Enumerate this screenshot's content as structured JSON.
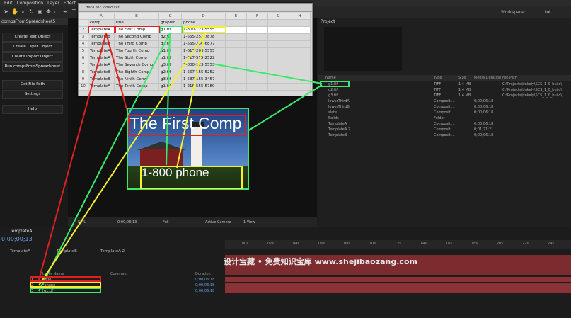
{
  "menu": [
    "Edit",
    "Composition",
    "Layer",
    "Effect"
  ],
  "toolbar": {
    "workspace_label": "Workspace:",
    "workspace_value": "tut"
  },
  "script_panel": {
    "tab": "compsFromSpreadsheet5",
    "buttons": [
      "Create Text Object",
      "Create Layer Object",
      "Create Import Object",
      "Run compsFromSpreadsheet",
      "Get File Path",
      "Settings",
      "help"
    ]
  },
  "sheet": {
    "title": "data for video.txt",
    "columns": [
      "A",
      "B",
      "C",
      "D",
      "E",
      "F",
      "G",
      "H"
    ],
    "rows": [
      [
        "comp",
        "title",
        "graphic",
        "phone"
      ],
      [
        "TemplateA",
        "The First Comp",
        "g1.tif",
        "1-800-123-5555"
      ],
      [
        "TemplateB",
        "The Second Comp",
        "g2.tif",
        "1-555-251-7878"
      ],
      [
        "TemplateB",
        "The Third Comp",
        "g3.tif",
        "1-555-256-6877"
      ],
      [
        "TemplateA",
        "The Fourth Comp",
        "g1.tif",
        "1-617-208-5555"
      ],
      [
        "TemplateA",
        "The Sixth Comp",
        "g1.tif",
        "1-617-555-2522"
      ],
      [
        "TemplateA",
        "The Seventh Comp",
        "g3.tif",
        "1-800-123-5555"
      ],
      [
        "TemplateB",
        "The Eighth Comp",
        "g2.tif",
        "1-567-555-5252"
      ],
      [
        "TemplateB",
        "The Ninth Comp",
        "g3.tif",
        "1-587-155-3457"
      ],
      [
        "TemplateA",
        "The Tenth Comp",
        "g1.tif",
        "1-216-555-5789"
      ]
    ]
  },
  "comp": {
    "title_text": "The First Comp",
    "phone_text": "1-800 phone"
  },
  "viewer_bar": {
    "zoom": "50%",
    "timecode": "0;00;08;13",
    "resolution": "Full",
    "camera": "Active Camera",
    "view": "1 View"
  },
  "project": {
    "tab": "Project",
    "headers": [
      "Name",
      "Type",
      "Size",
      "Media Duration",
      "File Path"
    ],
    "items": [
      {
        "name": "g1.tif",
        "type": "TIFF",
        "size": "1.4 MB",
        "duration": "",
        "path": "C:\\Projects\\tinkely\\SCS_1_0_build\\"
      },
      {
        "name": "g2.tif",
        "type": "TIFF",
        "size": "1.4 MB",
        "duration": "",
        "path": "C:\\Projects\\tinkely\\SCS_1_0_build\\"
      },
      {
        "name": "g3.tif",
        "type": "TIFF",
        "size": "1.4 MB",
        "duration": "",
        "path": "C:\\Projects\\tinkely\\SCS_1_0_build\\"
      },
      {
        "name": "lowerThirdA",
        "type": "Compositi...",
        "size": "",
        "duration": "0;00;06;18",
        "path": ""
      },
      {
        "name": "lowerThirdB",
        "type": "Compositi...",
        "size": "",
        "duration": "0;00;06;18",
        "path": ""
      },
      {
        "name": "slate",
        "type": "Compositi...",
        "size": "",
        "duration": "0;00;06;18",
        "path": ""
      },
      {
        "name": "Solids",
        "type": "Folder",
        "size": "",
        "duration": "",
        "path": ""
      },
      {
        "name": "TemplateA",
        "type": "Compositi...",
        "size": "",
        "duration": "0;00;06;18",
        "path": ""
      },
      {
        "name": "TemplateA 2",
        "type": "Compositi...",
        "size": "",
        "duration": "0;01;21;21",
        "path": ""
      },
      {
        "name": "TemplateB",
        "type": "Compositi...",
        "size": "",
        "duration": "0;00;06;18",
        "path": ""
      }
    ]
  },
  "timeline": {
    "tab": "TemplateA",
    "timecode": "0;00;00;13",
    "comp_tabs": [
      "TemplateA",
      "TemplateB",
      "TemplateA 2"
    ],
    "columns": {
      "layer_name": "Layer Name",
      "comment": "Comment",
      "duration": "Duration"
    },
    "layers": [
      {
        "num": "1",
        "name": "*title",
        "duration": "0;00;06;18"
      },
      {
        "num": "2",
        "name": "*phone",
        "duration": "0;00;06;18"
      },
      {
        "num": "3",
        "name": "[g1.tif]",
        "duration": "0;00;06;18"
      }
    ],
    "ruler": [
      "00s",
      "02s",
      "04s",
      "06s",
      "08s",
      "10s",
      "12s",
      "14s",
      "16s",
      "18s",
      "20s",
      "22s",
      "24s",
      "26s"
    ]
  },
  "watermark": "设计宝藏 • 免费知识宝库 www.shejibaozang.com",
  "colors": {
    "red": "#e02020",
    "green": "#3ee86a",
    "yellow": "#f4f030"
  }
}
